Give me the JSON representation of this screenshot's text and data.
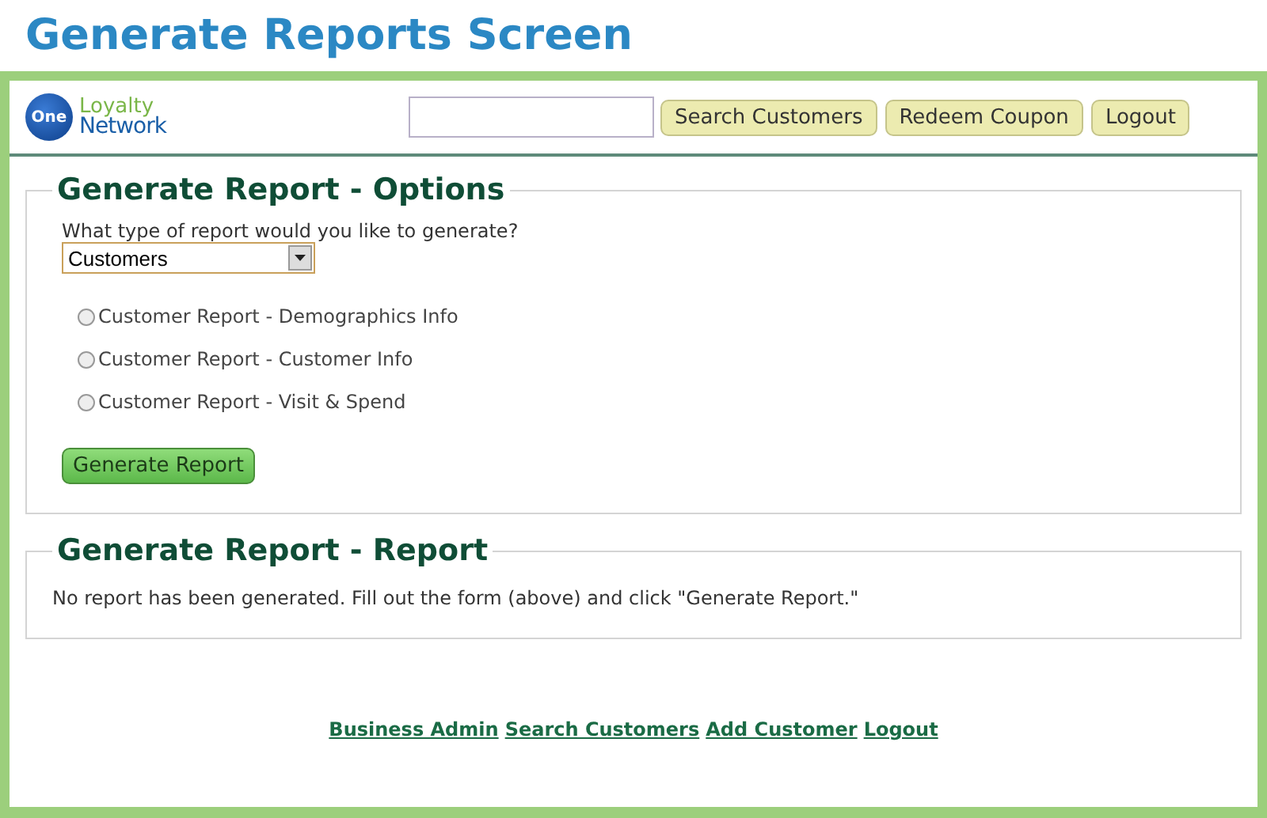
{
  "page_title": "Generate Reports Screen",
  "header": {
    "logo": {
      "badge": "One",
      "line1": "Loyalty",
      "line2": "Network"
    },
    "buttons": [
      "Search Customers",
      "Redeem Coupon",
      "Logout"
    ]
  },
  "options": {
    "legend": "Generate Report - Options",
    "question": "What type of report would you like to generate?",
    "select": {
      "value": "Customers"
    },
    "radios": [
      {
        "label": "Customer Report - Demographics Info",
        "selected": false
      },
      {
        "label": "Customer Report - Customer Info",
        "selected": false
      },
      {
        "label": "Customer Report - Visit & Spend",
        "selected": false
      }
    ],
    "submit": "Generate Report"
  },
  "report": {
    "legend": "Generate Report - Report",
    "message": "No report has been generated. Fill out the form (above) and click \"Generate Report.\""
  },
  "footer_links": [
    "Business Admin",
    "Search Customers",
    "Add Customer",
    "Logout"
  ]
}
